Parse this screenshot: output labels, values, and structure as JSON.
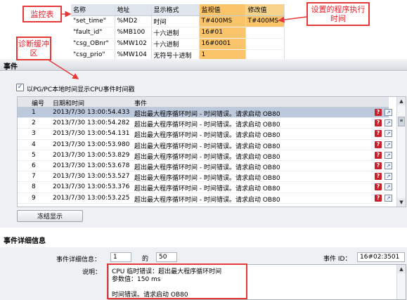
{
  "callouts": {
    "watch_table": "监控表",
    "diag_buffer": "诊断缓冲区",
    "program_exec_time": "设置的程序执行时间"
  },
  "watch_table": {
    "headers": [
      "名称",
      "地址",
      "显示格式",
      "监视值",
      "修改值"
    ],
    "rows": [
      [
        "\"set_time\"",
        "%MD2",
        "时间",
        "T#400MS",
        "T#400MS"
      ],
      [
        "\"fault_id\"",
        "%MB100",
        "十六进制",
        "16#01",
        ""
      ],
      [
        "\"csg_OBnr\"",
        "%MW102",
        "十六进制",
        "16#0001",
        ""
      ],
      [
        "\"csg_prio\"",
        "%MW104",
        "无符号十进制",
        "1",
        ""
      ]
    ]
  },
  "events": {
    "heading": "事件",
    "checkbox_label": "以PG/PC本地时间显示CPU事件时间戳",
    "checkbox_checked": true,
    "columns": {
      "no": "编号",
      "datetime": "日期和时间",
      "event": "事件"
    },
    "rows": [
      {
        "no": "1",
        "datetime": "2013/7/30 13:00:54.433",
        "event": "超出最大程序循环时间 - 时间错误。请求启动 OB80"
      },
      {
        "no": "2",
        "datetime": "2013/7/30 13:00:54.282",
        "event": "超出最大程序循环时间 - 时间错误。请求启动 OB80"
      },
      {
        "no": "3",
        "datetime": "2013/7/30 13:00:54.131",
        "event": "超出最大程序循环时间 - 时间错误。请求启动 OB80"
      },
      {
        "no": "4",
        "datetime": "2013/7/30 13:00:53.980",
        "event": "超出最大程序循环时间 - 时间错误。请求启动 OB80"
      },
      {
        "no": "5",
        "datetime": "2013/7/30 13:00:53.829",
        "event": "超出最大程序循环时间 - 时间错误。请求启动 OB80"
      },
      {
        "no": "6",
        "datetime": "2013/7/30 13:00:53.678",
        "event": "超出最大程序循环时间 - 时间错误。请求启动 OB80"
      },
      {
        "no": "7",
        "datetime": "2013/7/30 13:00:53.527",
        "event": "超出最大程序循环时间 - 时间错误。请求启动 OB80"
      },
      {
        "no": "8",
        "datetime": "2013/7/30 13:00:53.376",
        "event": "超出最大程序循环时间 - 时间错误。请求启动 OB80"
      },
      {
        "no": "9",
        "datetime": "2013/7/30 13:00:53.225",
        "event": "超出最大程序循环时间 - 时间错误。请求启动 OB80"
      }
    ],
    "row_icons": [
      "help-icon",
      "open-in-editor-icon"
    ],
    "freeze_button": "冻结显示"
  },
  "details": {
    "heading": "事件详细信息",
    "info_label": "事件详细信息：",
    "index": "1",
    "of_label": "的",
    "total": "50",
    "event_id_label": "事件 ID：",
    "event_id": "16#02:3501",
    "description_label": "说明：",
    "description_lines": [
      "CPU 临时错误：超出最大程序循环时间",
      "参数值：150 ms",
      "",
      "时间错误。请求启动 OB80"
    ]
  },
  "colors": {
    "callout_red": "#e53939",
    "monitor_value_bg": "#f9c46a",
    "selected_row": "#bcc9dc"
  }
}
